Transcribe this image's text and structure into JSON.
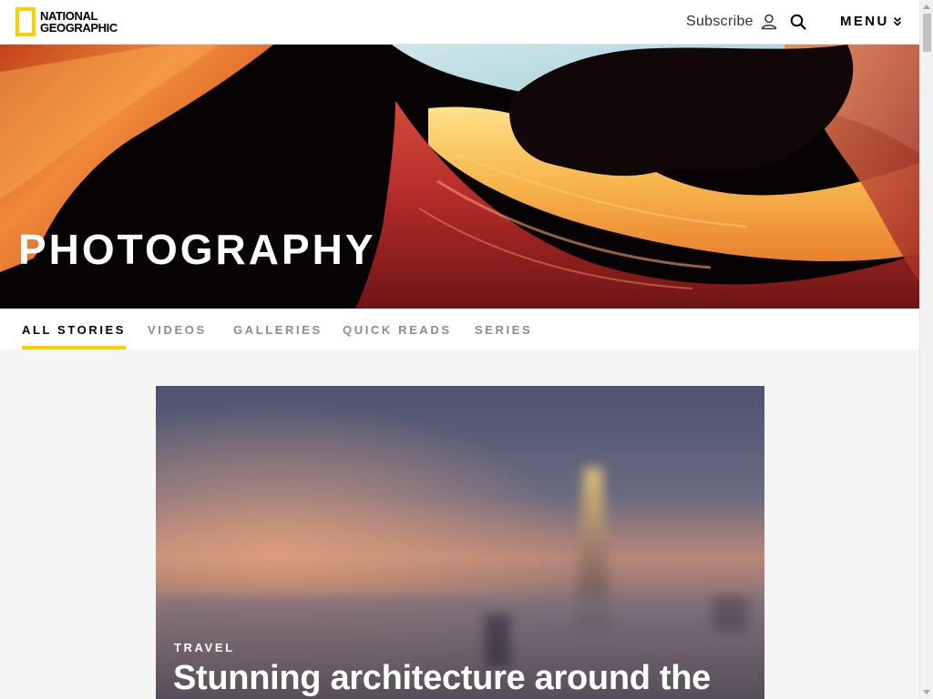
{
  "header": {
    "logo": {
      "line1": "NATIONAL",
      "line2": "GEOGRAPHIC",
      "color": "#ffce00"
    },
    "subscribe_label": "Subscribe",
    "icons": {
      "user": "user-icon",
      "search": "search-icon",
      "menu_chevron": "chevron-down-icon"
    },
    "menu_label": "MENU"
  },
  "hero": {
    "title": "PHOTOGRAPHY"
  },
  "tabs": [
    {
      "label": "ALL STORIES",
      "active": true
    },
    {
      "label": "VIDEOS",
      "active": false
    },
    {
      "label": "GALLERIES",
      "active": false
    },
    {
      "label": "QUICK READS",
      "active": false
    },
    {
      "label": "SERIES",
      "active": false
    }
  ],
  "featured_card": {
    "kicker": "TRAVEL",
    "headline": "Stunning architecture around the"
  },
  "colors": {
    "accent": "#ffce00",
    "tab_inactive": "#8c8c8c",
    "page_bg": "#f5f5f5"
  }
}
